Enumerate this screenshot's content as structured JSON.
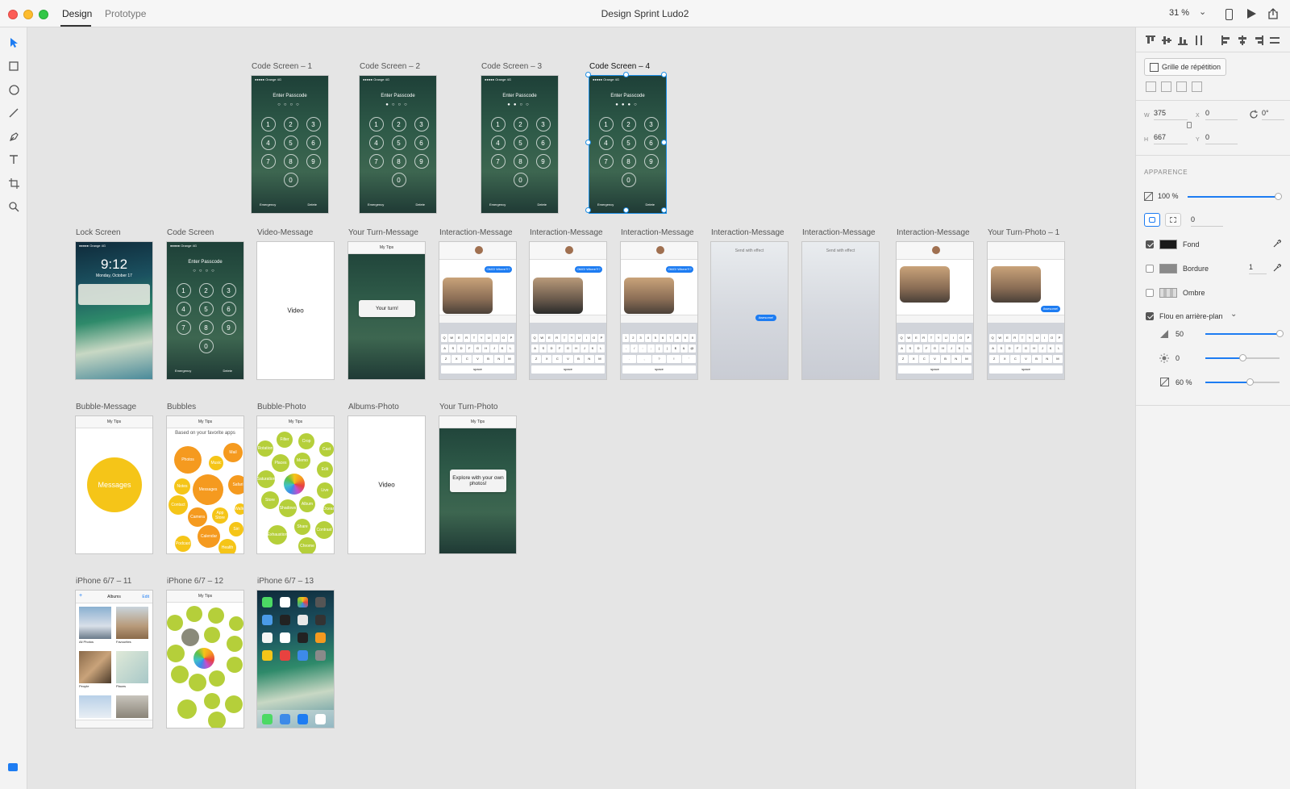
{
  "window": {
    "title": "Design Sprint Ludo2",
    "tabs": [
      "Design",
      "Prototype"
    ],
    "zoom": "31 %"
  },
  "artboards": {
    "row1": [
      {
        "label": "Code Screen – 1",
        "passcode_title": "Enter Passcode",
        "emergency": "Emergency",
        "delete": "Delete"
      },
      {
        "label": "Code Screen – 2",
        "passcode_title": "Enter Passcode",
        "emergency": "Emergency",
        "delete": "Delete"
      },
      {
        "label": "Code Screen – 3",
        "passcode_title": "Enter Passcode",
        "emergency": "Emergency",
        "delete": "Delete"
      },
      {
        "label": "Code Screen – 4",
        "passcode_title": "Enter Passcode",
        "emergency": "Emergency",
        "delete": "Delete"
      }
    ],
    "row2": [
      {
        "label": "Lock Screen",
        "time": "9:12",
        "date": "Monday, October 17"
      },
      {
        "label": "Code Screen",
        "passcode_title": "Enter Passcode",
        "emergency": "Emergency",
        "delete": "Delete"
      },
      {
        "label": "Video-Message",
        "center": "Video"
      },
      {
        "label": "Your Turn-Message",
        "popup": "Your turn!",
        "bar": "My Tips"
      },
      {
        "label": "Interaction-Message",
        "bubble": "OMG! Where?!?"
      },
      {
        "label": "Interaction-Message",
        "bubble": "OMG! Where?!?"
      },
      {
        "label": "Interaction-Message",
        "bubble": "OMG! Where?!?"
      },
      {
        "label": "Interaction-Message",
        "effect": "Send with effect",
        "sent": "Awesome!"
      },
      {
        "label": "Interaction-Message",
        "effect": "Send with effect"
      },
      {
        "label": "Interaction-Message"
      },
      {
        "label": "Your Turn-Photo – 1",
        "sent": "Awesome!"
      }
    ],
    "row3": [
      {
        "label": "Bubble-Message",
        "bar": "My Tips",
        "bubble": "Messages"
      },
      {
        "label": "Bubbles",
        "bar": "My Tips",
        "subtitle": "Based on your favorite apps",
        "bubbles": [
          "Photos",
          "Music",
          "Mail",
          "Messages",
          "Safari",
          "Notes",
          "Contact",
          "Camera",
          "App Store",
          "Calendar",
          "Siri",
          "Health",
          "Podcast",
          "Wallet"
        ]
      },
      {
        "label": "Bubble-Photo",
        "bar": "My Tips",
        "bubbles": [
          "Filter",
          "Crop",
          "Cast",
          "Rotation",
          "Places",
          "Memo",
          "Edit",
          "Saturation",
          "Live",
          "Store",
          "Shadows",
          "Album",
          "Share",
          "Contrast",
          "Exhaustion",
          "Chrome",
          "Ocean"
        ]
      },
      {
        "label": "Albums-Photo",
        "center": "Video"
      },
      {
        "label": "Your Turn-Photo",
        "bar": "My Tips",
        "popup": "Explore with your own photos!"
      }
    ],
    "row4": [
      {
        "label": "iPhone 6/7 – 11",
        "bar_title": "Albums",
        "bar_left": "+",
        "bar_right": "Edit",
        "albums": [
          "All Photos",
          "Favourites",
          "People",
          "Places"
        ]
      },
      {
        "label": "iPhone 6/7 – 12",
        "bar": "My Tips"
      },
      {
        "label": "iPhone 6/7 – 13"
      }
    ]
  },
  "panel": {
    "repeat_grid": "Grille de répétition",
    "w_label": "W",
    "w": "375",
    "h_label": "H",
    "h": "667",
    "x_label": "X",
    "x": "0",
    "y_label": "Y",
    "y": "0",
    "rotation": "0°",
    "appearance_title": "APPARENCE",
    "opacity": "100 %",
    "opacity_fraction": 1.0,
    "corner_radius": "0",
    "fill_label": "Fond",
    "fill_color": "#1a1a1a",
    "fill_checked": true,
    "border_label": "Bordure",
    "border_color": "#8a8a8a",
    "border_width": "1",
    "border_checked": false,
    "shadow_label": "Ombre",
    "shadow_checked": false,
    "blur_label": "Flou en arrière-plan",
    "blur_checked": true,
    "blur_amount": "50",
    "blur_amount_fraction": 1.0,
    "brightness": "0",
    "brightness_fraction": 0.5,
    "effect_opacity": "60 %",
    "effect_opacity_fraction": 0.6
  },
  "colors": {
    "accent": "#1d7cf2",
    "selection": "#1d8fe6"
  }
}
